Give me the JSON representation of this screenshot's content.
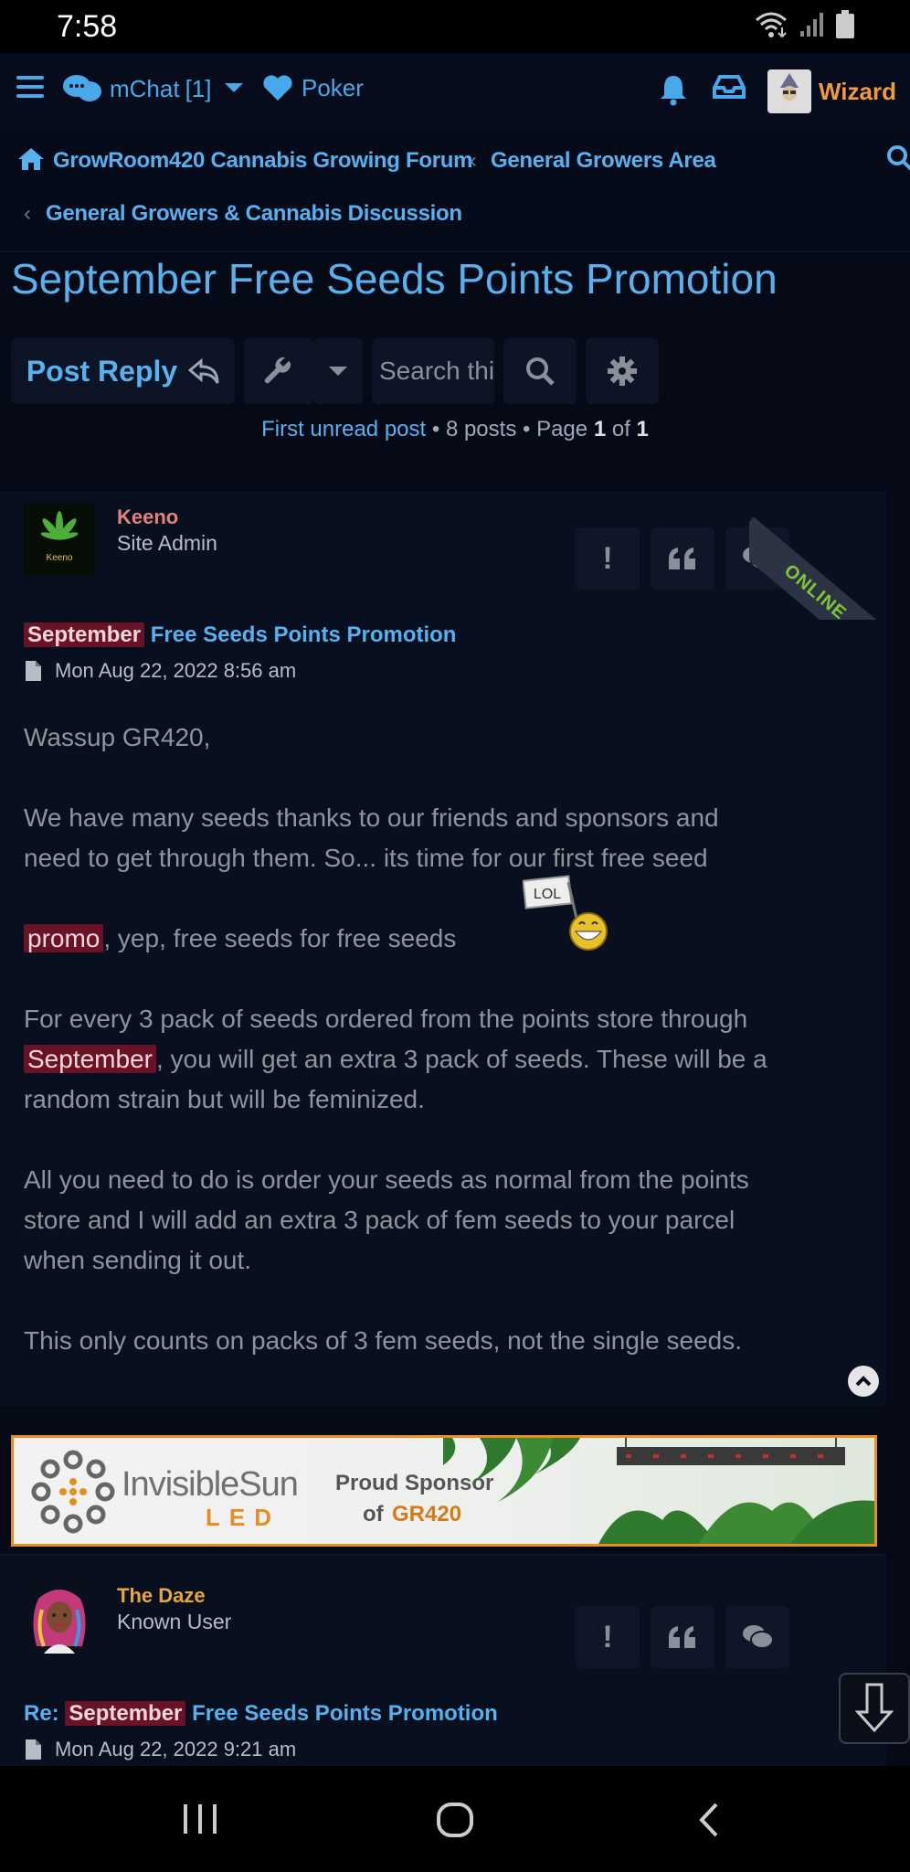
{
  "status_bar": {
    "time": "7:58"
  },
  "topbar": {
    "chat_label": "mChat",
    "chat_count": "[1]",
    "poker_label": "Poker",
    "user_name": "Wizard"
  },
  "breadcrumbs": {
    "home": "GrowRoom420 Cannabis Growing Forum",
    "area": "General Growers Area",
    "forum": "General Growers & Cannabis Discussion"
  },
  "topic_title": "September Free Seeds Points Promotion",
  "actions": {
    "post_reply": "Post Reply",
    "search_placeholder": "Search this topic"
  },
  "pagination": {
    "first_unread": "First unread post",
    "posts": "8 posts",
    "page_word": "Page",
    "page_current": "1",
    "of_word": "of",
    "page_total": "1"
  },
  "posts": [
    {
      "author": "Keeno",
      "author_color": "#e8807a",
      "rank": "Site Admin",
      "online_label": "ONLINE",
      "subject_highlight": "September",
      "subject_rest": "Free Seeds Points Promotion",
      "date": "Mon Aug 22, 2022 8:56 am",
      "avatar_text": "Keeno",
      "smiley_label": "LOL",
      "body": {
        "l1": "Wassup GR420,",
        "l2": "We have many seeds thanks to our friends and sponsors and",
        "l3": "need to get through them. So... its time for our first free seed",
        "l4_hl": "promo",
        "l4_rest": ", yep, free seeds for free seeds",
        "l5": "For every 3 pack of seeds ordered from the points store through",
        "l6_hl": "September",
        "l6_rest": ", you will get an extra 3 pack of seeds. These will be a",
        "l7": "random strain but will be feminized.",
        "l8": "All you need to do is order your seeds as normal from the points",
        "l9": "store and I will add an extra 3 pack of fem seeds to your parcel",
        "l10": "when sending it out.",
        "l11": "This only counts on packs of 3 fem seeds, not the single seeds."
      }
    },
    {
      "author": "The Daze",
      "author_color": "#e8a838",
      "rank": "Known User",
      "subject_prefix": "Re:",
      "subject_highlight": "September",
      "subject_rest": "Free Seeds Points Promotion",
      "date": "Mon Aug 22, 2022 9:21 am"
    }
  ],
  "sponsor": {
    "brand_line1": "InvisibleSun",
    "brand_line2": "LED",
    "tagline1": "Proud Sponsor",
    "tagline2_prefix": "of",
    "tagline2_site": "GR420"
  },
  "colors": {
    "link": "#58b0ee",
    "highlight_bg": "#6a1226",
    "background": "#060a17",
    "accent_orange": "#e88c28"
  }
}
